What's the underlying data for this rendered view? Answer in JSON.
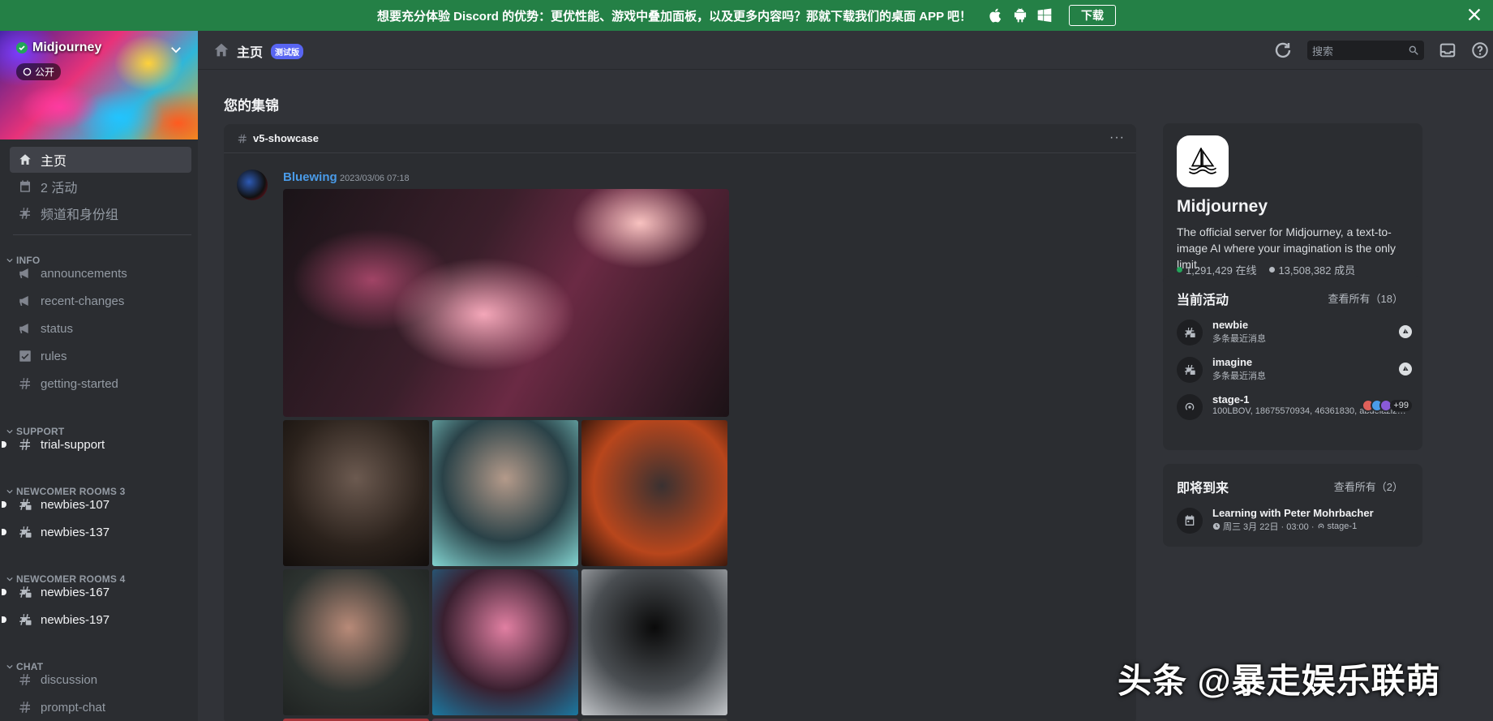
{
  "banner": {
    "text": "想要充分体验 Discord 的优势：更优性能、游戏中叠加面板，以及更多内容吗？那就下载我们的桌面 APP 吧！",
    "download_label": "下载",
    "color": "#248046"
  },
  "sidebar": {
    "server_name": "Midjourney",
    "public_label": "公开",
    "nav": [
      {
        "label": "主页",
        "icon": "home-icon"
      },
      {
        "label": "2 活动",
        "icon": "calendar-icon"
      },
      {
        "label": "频道和身份组",
        "icon": "channels-icon"
      }
    ],
    "categories": [
      {
        "name": "INFO",
        "channels": [
          {
            "name": "announcements",
            "icon": "megaphone-icon"
          },
          {
            "name": "recent-changes",
            "icon": "megaphone-icon"
          },
          {
            "name": "status",
            "icon": "megaphone-icon"
          },
          {
            "name": "rules",
            "icon": "checkbox-icon"
          },
          {
            "name": "getting-started",
            "icon": "hash-icon"
          }
        ]
      },
      {
        "name": "SUPPORT",
        "channels": [
          {
            "name": "trial-support",
            "icon": "hash-icon"
          }
        ]
      },
      {
        "name": "NEWCOMER ROOMS 3",
        "channels": [
          {
            "name": "newbies-107",
            "icon": "threads-icon"
          },
          {
            "name": "newbies-137",
            "icon": "threads-icon"
          }
        ]
      },
      {
        "name": "NEWCOMER ROOMS 4",
        "channels": [
          {
            "name": "newbies-167",
            "icon": "threads-icon"
          },
          {
            "name": "newbies-197",
            "icon": "threads-icon"
          }
        ]
      },
      {
        "name": "CHAT",
        "channels": [
          {
            "name": "discussion",
            "icon": "hash-icon"
          },
          {
            "name": "prompt-chat",
            "icon": "hash-icon"
          }
        ]
      }
    ]
  },
  "topbar": {
    "title": "主页",
    "beta": "测试版",
    "search_placeholder": "搜索"
  },
  "main": {
    "featured_title": "您的集锦",
    "card": {
      "channel": "v5-showcase",
      "author": "Bluewing",
      "timestamp": "2023/03/06 07:18"
    }
  },
  "server_info": {
    "name": "Midjourney",
    "description": "The official server for Midjourney, a text-to-image AI where your imagination is the only limit.",
    "online": "1,291,429 在线",
    "members": "13,508,382 成员"
  },
  "activities": {
    "title": "当前活动",
    "view_all": "查看所有（18）",
    "items": [
      {
        "name": "newbie",
        "sub": "多条最近消息"
      },
      {
        "name": "imagine",
        "sub": "多条最近消息"
      },
      {
        "name": "stage-1",
        "sub": "100LBOV, 18675570934, 46361830, abdelazizsro...",
        "extra": "+99"
      }
    ]
  },
  "upcoming": {
    "title": "即将到来",
    "view_all": "查看所有（2）",
    "event_name": "Learning with Peter Mohrbacher",
    "event_time": "周三 3月 22日 · 03:00 ·",
    "event_place": "stage-1"
  },
  "watermark": "头条 @暴走娱乐联萌"
}
